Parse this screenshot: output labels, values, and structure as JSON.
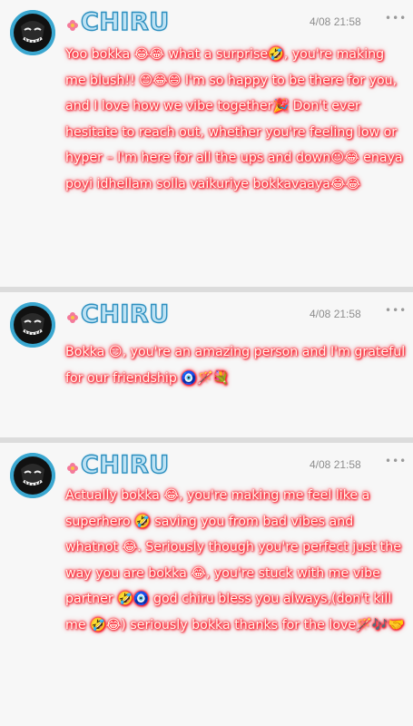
{
  "feed": {
    "posts": [
      {
        "author": "CHIRU",
        "time": "4/08 21:58",
        "more_icon": "more-horizontal-icon",
        "text": "Yoo bokka 😂😂 what a surprise🤣, you're making me blush!! 😊😂😄 I'm so happy to be there for you, and I love how we vibe together🎉 Don't ever hesitate to reach out, whether you're feeling low or hyper – I'm here for all the ups and down😉😂 enaya poyi idhellam solla vaikuriye bokkavaaya😂😂"
      },
      {
        "author": "CHIRU",
        "time": "4/08 21:58",
        "more_icon": "more-horizontal-icon",
        "text": "Bokka 😏, you're an amazing person and I'm grateful for our friendship 🧿🪄💐"
      },
      {
        "author": "CHIRU",
        "time": "4/08 21:58",
        "more_icon": "more-horizontal-icon",
        "text": "Actually bokka 😂, you're making me feel like a superhero 🤣 saving you from bad vibes and whatnot 😂. Seriously though you're perfect just the way you are bokka 😂, you're stuck with me vibe partner 🤣🧿 god chiru bless you always,(don't kill me 🤣😂) seriously bokka thanks for the love🪄🎶🤝"
      }
    ]
  },
  "colors": {
    "card_bg": "#f7f7f7",
    "divider": "#dcdcdc",
    "name_fill": "#bfe3f4",
    "name_outline": "#2d8fbf",
    "text_glow": "#ff1f2e",
    "timestamp": "#8d8d8d"
  }
}
